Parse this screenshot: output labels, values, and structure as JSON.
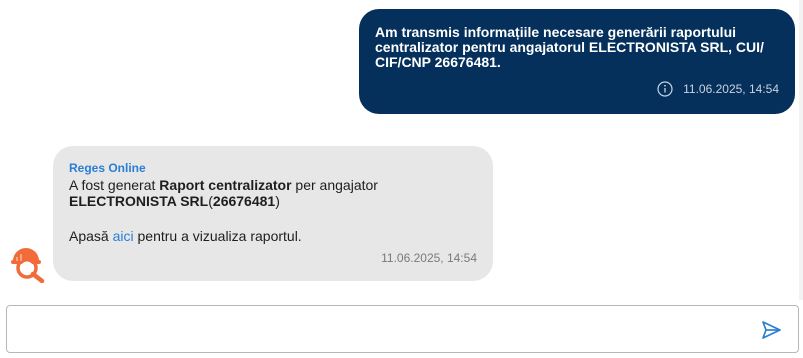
{
  "conversation": {
    "outgoing_message": {
      "text": "Am transmis informațiile necesare generării raportului centralizator pentru angajatorul ELECTRONISTA SRL, CUI/ CIF/CNP 26676481.",
      "timestamp": "11.06.2025, 14:54",
      "status_icon": "info-icon"
    },
    "incoming_message": {
      "sender": "Reges Online",
      "line1_prefix": "A fost generat ",
      "report_name": "Raport centralizator",
      "line1_suffix": " per angajator",
      "employer": "ELECTRONISTA SRL",
      "open_paren": "(",
      "cui": "26676481",
      "close_paren": ")",
      "cta_prefix": "Apasă ",
      "cta_link": "aici",
      "cta_suffix": " pentru a vizualiza raportul.",
      "timestamp": "11.06.2025, 14:54",
      "avatar_icon": "search-helmet-avatar"
    }
  },
  "composer": {
    "value": "",
    "placeholder": "",
    "send_icon": "send-icon"
  },
  "colors": {
    "outgoing_bg": "#04305b",
    "incoming_bg": "#e7e7e7",
    "accent": "#2a7fd4",
    "avatar_orange": "#f26b3a"
  }
}
